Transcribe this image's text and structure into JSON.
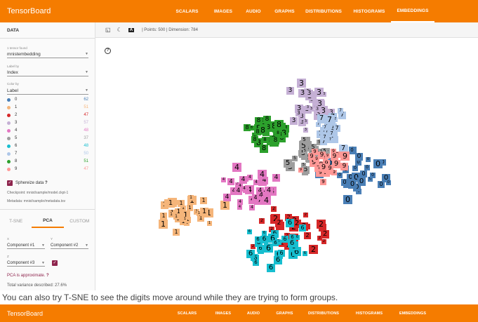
{
  "app": {
    "title": "TensorBoard"
  },
  "nav": [
    {
      "label": "SCALARS",
      "active": false
    },
    {
      "label": "IMAGES",
      "active": false
    },
    {
      "label": "AUDIO",
      "active": false
    },
    {
      "label": "GRAPHS",
      "active": false
    },
    {
      "label": "DISTRIBUTIONS",
      "active": false
    },
    {
      "label": "HISTOGRAMS",
      "active": false
    },
    {
      "label": "EMBEDDINGS",
      "active": true
    }
  ],
  "sidebar": {
    "section_title": "DATA",
    "tensor_label": "1 tensor found",
    "tensor_value": "mnistembedding",
    "labelby_label": "Label by",
    "labelby_value": "Index",
    "colorby_label": "Color by",
    "colorby_value": "Label",
    "legend": [
      {
        "label": "0",
        "count": "62",
        "color": "#4a7fb6"
      },
      {
        "label": "1",
        "count": "51",
        "color": "#f5b57a"
      },
      {
        "label": "2",
        "count": "47",
        "color": "#d62728"
      },
      {
        "label": "3",
        "count": "57",
        "color": "#c5b0d5"
      },
      {
        "label": "4",
        "count": "48",
        "color": "#e377c2"
      },
      {
        "label": "5",
        "count": "37",
        "color": "#9e9e9e"
      },
      {
        "label": "6",
        "count": "48",
        "color": "#17becf"
      },
      {
        "label": "7",
        "count": "50",
        "color": "#aec7e8"
      },
      {
        "label": "8",
        "count": "51",
        "color": "#2ca02c"
      },
      {
        "label": "9",
        "count": "47",
        "color": "#ff9896"
      }
    ],
    "sphereize_label": "Sphereize data",
    "checkpoint_text": "Checkpoint:   mnist/sample/model.ckpt-1",
    "metadata_text": "Metadata:   mnist/sample/metadata.tsv",
    "tabs": [
      {
        "label": "T-SNE",
        "active": false
      },
      {
        "label": "PCA",
        "active": true
      },
      {
        "label": "CUSTOM",
        "active": false
      }
    ],
    "x_label": "X",
    "x_value": "Component #1",
    "y_label": "Y",
    "y_value": "Component #2",
    "z_label": "Z",
    "z_value": "Component #3",
    "pca_note": "PCA is approximate.",
    "variance_text": "Total variance described: 27.6%"
  },
  "toolbar": {
    "points_text": "| Points: 500 | Dimension: 784"
  },
  "caption": "You can also try T-SNE to see the digits move around while they are trying to form groups.",
  "bottom_bar": {
    "title": "TensorBoard",
    "nav": [
      "SCALARS",
      "IMAGES",
      "AUDIO",
      "GRAPHS",
      "DISTRIBUTIONS",
      "HISTOGRAMS",
      "EMBEDDINGS"
    ]
  }
}
